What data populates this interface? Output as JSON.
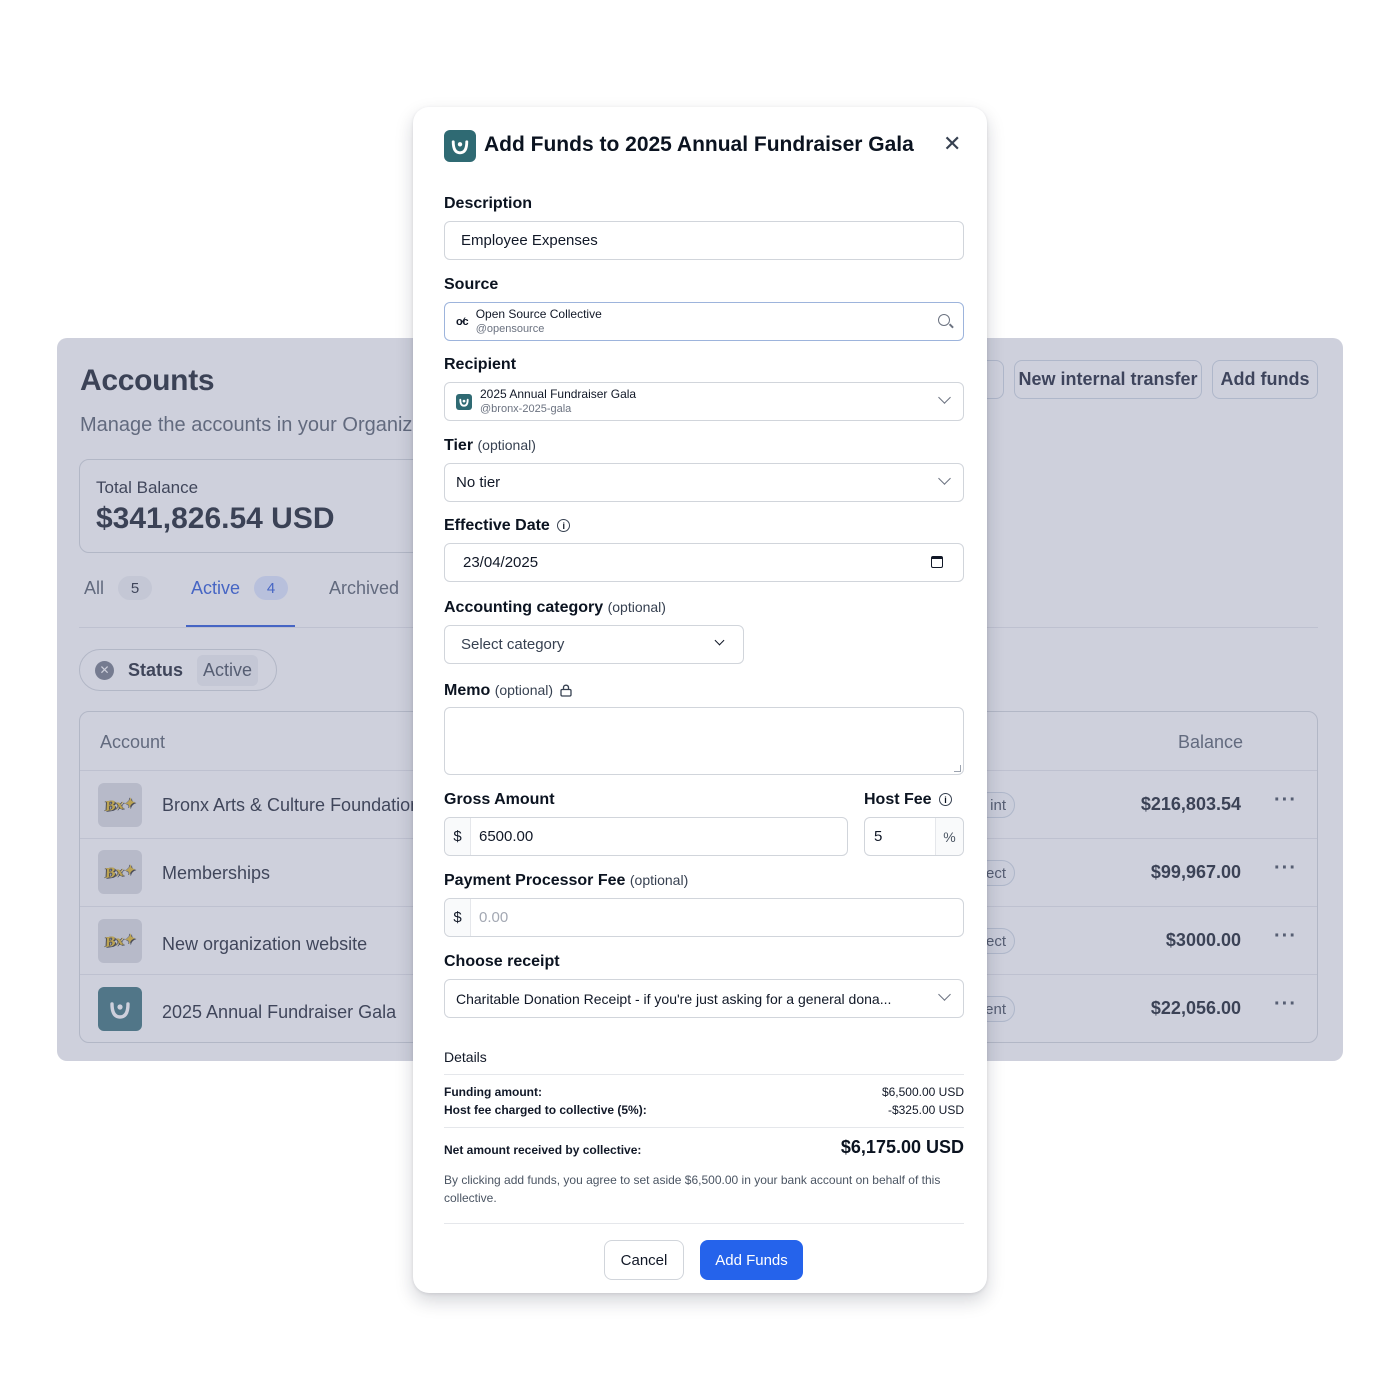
{
  "accounts_page": {
    "title": "Accounts",
    "subtitle": "Manage the accounts in your Organization",
    "actions": {
      "new_internal_transfer": "New internal transfer",
      "add_funds": "Add funds"
    },
    "total_balance": {
      "label": "Total Balance",
      "value": "$341,826.54 USD"
    },
    "tabs": [
      {
        "label": "All",
        "count": "5"
      },
      {
        "label": "Active",
        "count": "4"
      },
      {
        "label": "Archived"
      }
    ],
    "filter": {
      "label": "Status",
      "value": "Active"
    },
    "table": {
      "headers": {
        "account": "Account",
        "balance": "Balance"
      },
      "rows": [
        {
          "name": "Bronx Arts & Culture Foundation",
          "tag": "int",
          "balance": "$216,803.54"
        },
        {
          "name": "Memberships",
          "tag": "ect",
          "balance": "$99,967.00"
        },
        {
          "name": "New organization website",
          "tag": "ect",
          "balance": "$3000.00"
        },
        {
          "name": "2025 Annual Fundraiser Gala",
          "tag": "ent",
          "balance": "$22,056.00"
        }
      ]
    }
  },
  "modal": {
    "title": "Add Funds to 2025 Annual Fundraiser Gala",
    "description": {
      "label": "Description",
      "value": "Employee Expenses"
    },
    "source": {
      "label": "Source",
      "name": "Open Source Collective",
      "handle": "@opensource"
    },
    "recipient": {
      "label": "Recipient",
      "name": "2025 Annual Fundraiser Gala",
      "handle": "@bronx-2025-gala"
    },
    "tier": {
      "label": "Tier",
      "optional": "(optional)",
      "value": "No tier"
    },
    "effective_date": {
      "label": "Effective Date",
      "value": "23/04/2025"
    },
    "accounting_category": {
      "label": "Accounting category",
      "optional": "(optional)",
      "placeholder": "Select category"
    },
    "memo": {
      "label": "Memo",
      "optional": "(optional)"
    },
    "gross_amount": {
      "label": "Gross Amount",
      "currency": "$",
      "value": "6500.00"
    },
    "host_fee": {
      "label": "Host Fee",
      "value": "5",
      "unit": "%"
    },
    "processor_fee": {
      "label": "Payment Processor Fee",
      "optional": "(optional)",
      "currency": "$",
      "placeholder": "0.00"
    },
    "receipt": {
      "label": "Choose receipt",
      "value": "Charitable Donation Receipt - if you're just asking for a general dona..."
    },
    "details": {
      "title": "Details",
      "funding_amount_label": "Funding amount:",
      "funding_amount_value": "$6,500.00 USD",
      "host_fee_label": "Host fee charged to collective (5%):",
      "host_fee_value": "-$325.00 USD",
      "net_label": "Net amount received by collective:",
      "net_value": "$6,175.00 USD",
      "disclaimer": "By clicking add funds, you agree to set aside $6,500.00 in your bank account on behalf of this collective."
    },
    "cancel_label": "Cancel",
    "submit_label": "Add Funds"
  },
  "colors": {
    "primary": "#2563eb",
    "active_tab": "#1d4ed8",
    "collective_logo": "#2f6a73",
    "overlay": "#858aa8"
  },
  "icons": {
    "close": "close-icon",
    "search": "search-icon",
    "calendar": "calendar-icon",
    "info": "info-icon",
    "lock": "lock-icon",
    "chevron": "chevron-down-icon",
    "more": "more-horizontal-icon"
  }
}
